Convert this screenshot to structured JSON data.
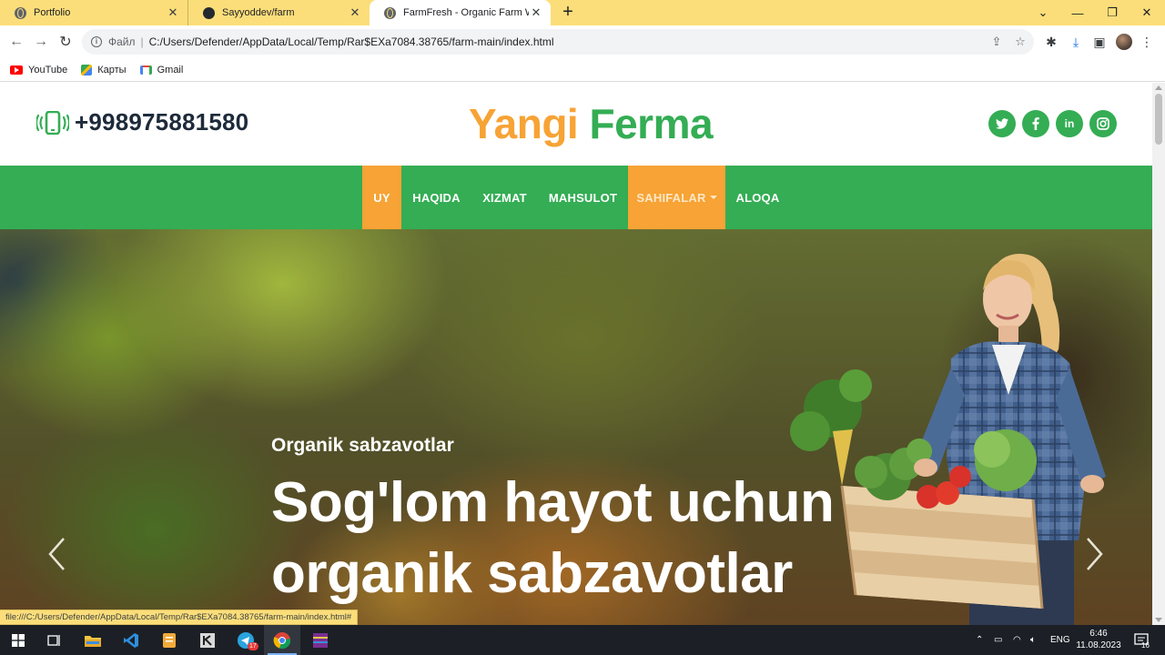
{
  "browser": {
    "tabs": [
      {
        "title": "Portfolio",
        "active": false,
        "icon": "globe-icon"
      },
      {
        "title": "Sayyoddev/farm",
        "active": false,
        "icon": "github-icon"
      },
      {
        "title": "FarmFresh - Organic Farm Websit",
        "active": true,
        "icon": "globe-icon"
      }
    ],
    "address": {
      "scheme_label": "Файл",
      "url": "C:/Users/Defender/AppData/Local/Temp/Rar$EXa7084.38765/farm-main/index.html"
    },
    "bookmarks": [
      {
        "label": "YouTube",
        "icon": "youtube-icon"
      },
      {
        "label": "Карты",
        "icon": "maps-icon"
      },
      {
        "label": "Gmail",
        "icon": "gmail-icon"
      }
    ],
    "status_url": "file:///C:/Users/Defender/AppData/Local/Temp/Rar$EXa7084.38765/farm-main/index.html#"
  },
  "site": {
    "phone": "+998975881580",
    "brand": {
      "part1": "Yangi",
      "part2": "Ferma"
    },
    "socials": [
      {
        "name": "twitter",
        "glyph": "t"
      },
      {
        "name": "facebook",
        "glyph": "f"
      },
      {
        "name": "linkedin",
        "glyph": "in"
      },
      {
        "name": "instagram",
        "glyph": "◎"
      }
    ],
    "nav": [
      {
        "label": "UY",
        "state": "active"
      },
      {
        "label": "HAQIDA"
      },
      {
        "label": "XIZMAT"
      },
      {
        "label": "MAHSULOT"
      },
      {
        "label": "SAHIFALAR",
        "state": "dropdown"
      },
      {
        "label": "ALOQA"
      }
    ],
    "hero": {
      "subtitle": "Organik sabzavotlar",
      "title_line1": "Sog'lom hayot uchun",
      "title_line2": "organik sabzavotlar"
    }
  },
  "taskbar": {
    "lang": "ENG",
    "time": "6:46",
    "date": "11.08.2023",
    "notifications": "16",
    "telegram_badge": "17"
  },
  "colors": {
    "green": "#34ad54",
    "orange": "#f7a335",
    "tab_bar": "#fbde7a"
  }
}
